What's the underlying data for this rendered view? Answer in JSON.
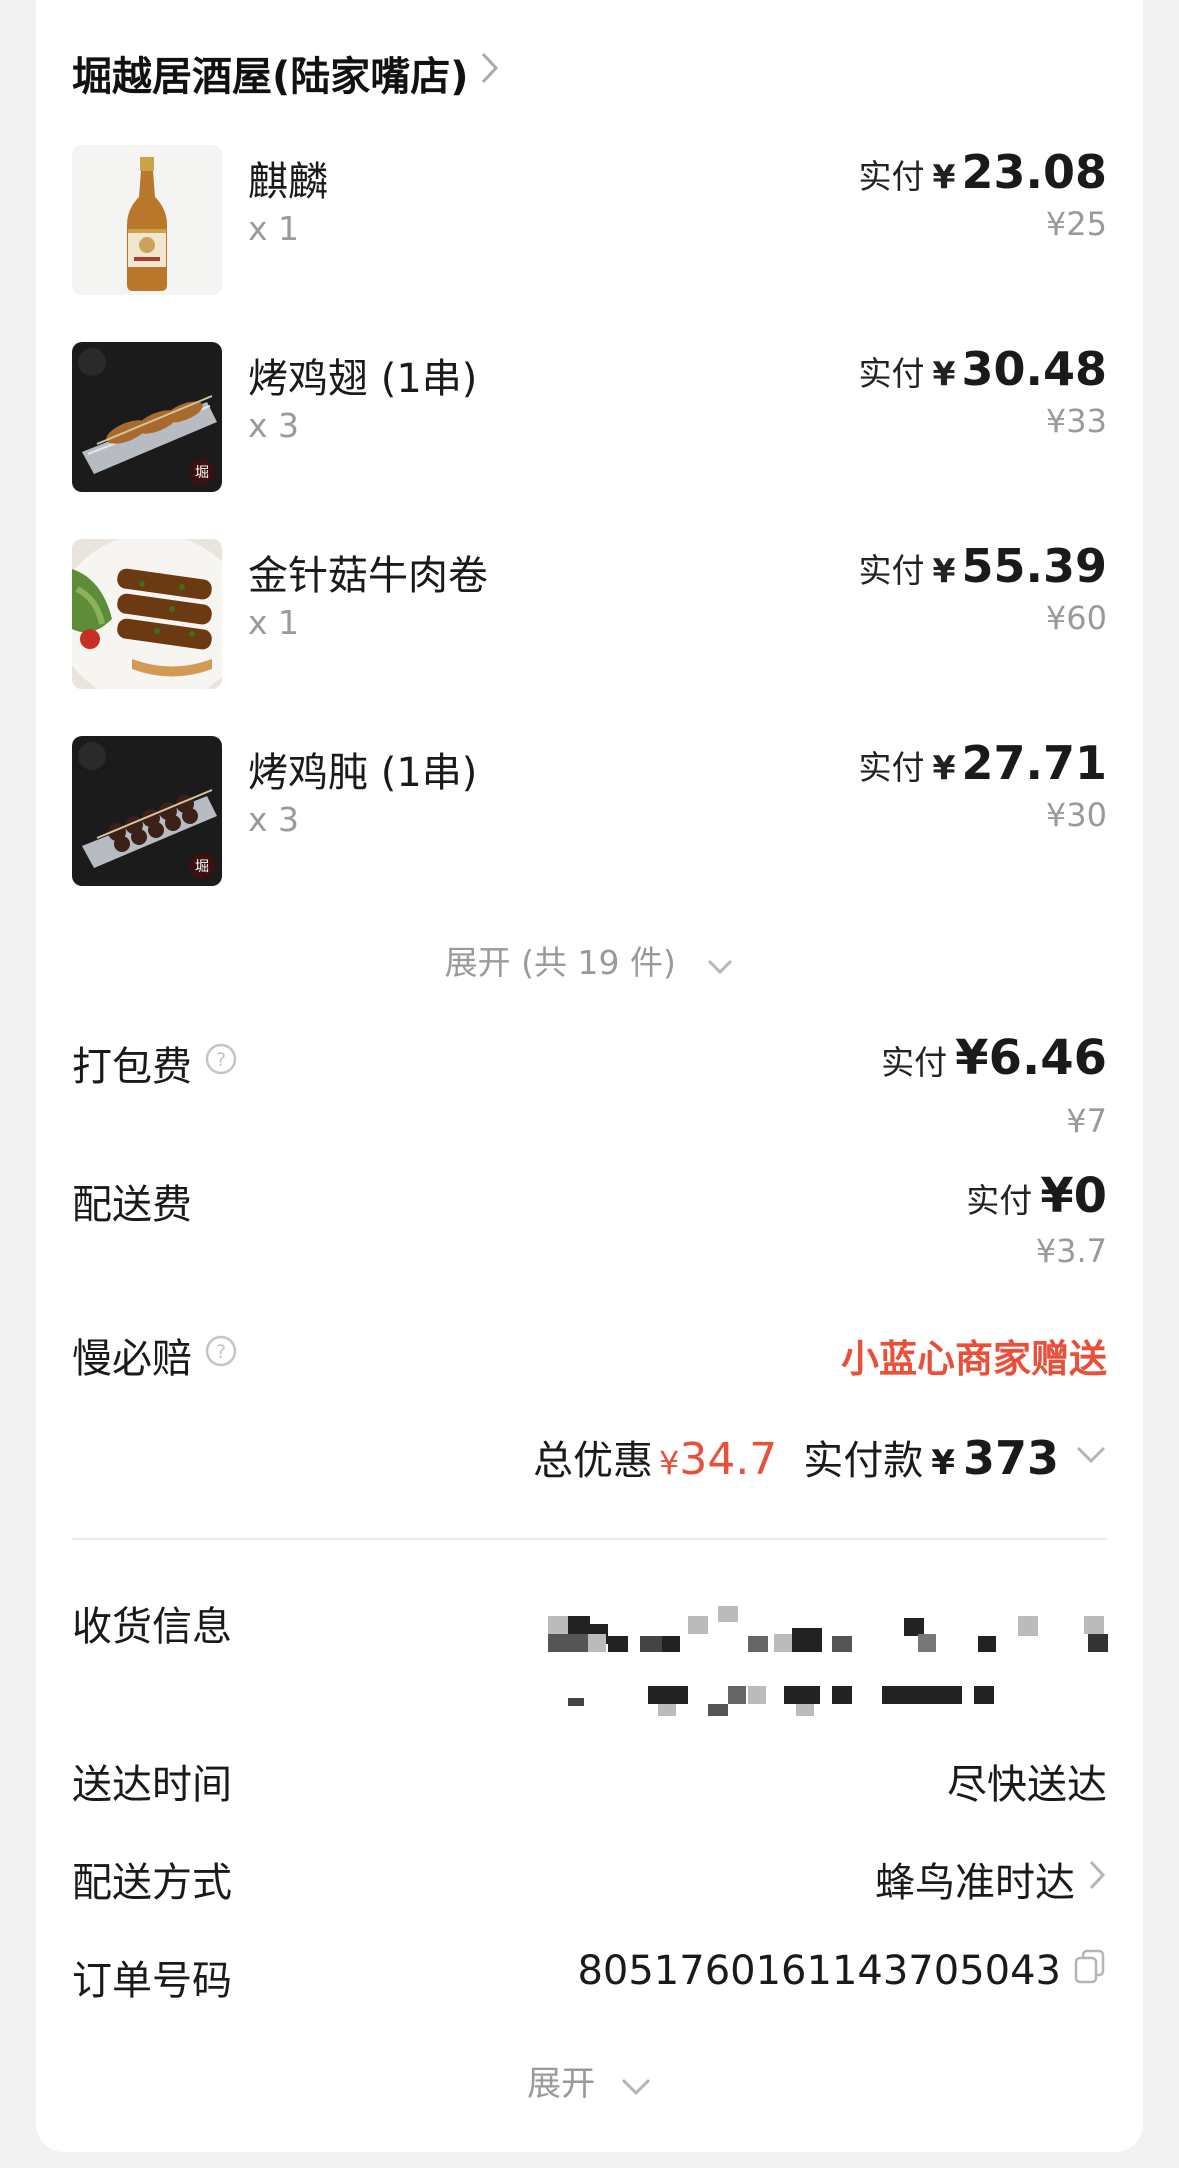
{
  "store": {
    "name": "堀越居酒屋(陆家嘴店)"
  },
  "items": [
    {
      "name": "麒麟",
      "qty": "x 1",
      "paid_label": "实付",
      "currency": "¥",
      "paid": "23.08",
      "original": "¥25",
      "image": "beer-bottle"
    },
    {
      "name": "烤鸡翅 (1串)",
      "qty": "x 3",
      "paid_label": "实付",
      "currency": "¥",
      "paid": "30.48",
      "original": "¥33",
      "image": "grilled-skewers"
    },
    {
      "name": "金针菇牛肉卷",
      "qty": "x 1",
      "paid_label": "实付",
      "currency": "¥",
      "paid": "55.39",
      "original": "¥60",
      "image": "beef-rolls"
    },
    {
      "name": "烤鸡肫 (1串)",
      "qty": "x 3",
      "paid_label": "实付",
      "currency": "¥",
      "paid": "27.71",
      "original": "¥30",
      "image": "grilled-skewers-dark"
    }
  ],
  "expand_items": "展开 (共 19 件)",
  "fees": {
    "packing": {
      "label": "打包费",
      "paid_label": "实付",
      "paid": "¥6.46",
      "original": "¥7"
    },
    "delivery": {
      "label": "配送费",
      "paid_label": "实付",
      "paid": "¥0",
      "original": "¥3.7"
    },
    "slow_compensation": {
      "label": "慢必赔",
      "value": "小蓝心商家赠送"
    }
  },
  "totals": {
    "discount_label": "总优惠",
    "discount_currency": "¥",
    "discount": "34.7",
    "paid_label": "实付款",
    "paid_currency": "¥",
    "paid": "373"
  },
  "order_info": {
    "address_label": "收货信息",
    "delivery_time_label": "送达时间",
    "delivery_time": "尽快送达",
    "delivery_method_label": "配送方式",
    "delivery_method": "蜂鸟准时达",
    "order_no_label": "订单号码",
    "order_no": "8051760161143705043"
  },
  "expand_bottom": "展开",
  "colors": {
    "accent_red": "#e8503a",
    "muted": "#9a9a9a",
    "background": "#f2f2f2"
  }
}
